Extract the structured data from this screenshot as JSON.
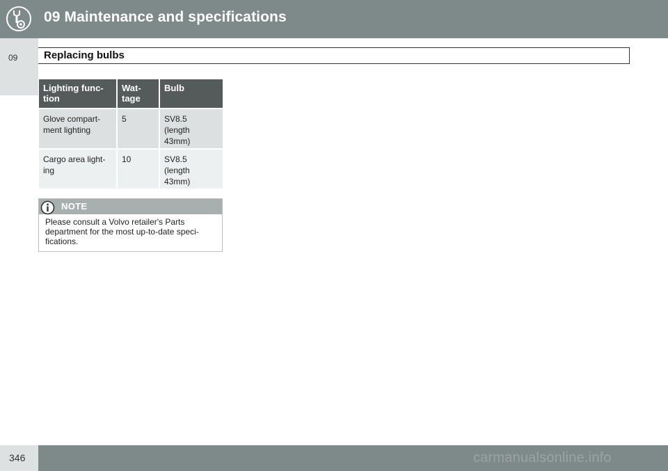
{
  "header": {
    "chapter_title": "09 Maintenance and specifications",
    "chapter_icon": "wrench-gear-icon"
  },
  "side_tab": {
    "chapter_number": "09"
  },
  "section": {
    "title": "Replacing bulbs"
  },
  "table": {
    "columns": [
      "Lighting func-\ntion",
      "Wat-\ntage",
      "Bulb"
    ],
    "rows": [
      [
        "Glove compart-\nment lighting",
        "5",
        "SV8.5\n(length\n43mm)"
      ],
      [
        "Cargo area light-\ning",
        "10",
        "SV8.5\n(length\n43mm)"
      ]
    ]
  },
  "note": {
    "icon": "info-icon",
    "label": "NOTE",
    "text": "Please consult a Volvo retailer's Parts\ndepartment for the most up-to-date speci-\nfications."
  },
  "footer": {
    "page_number": "346",
    "watermark": "carmanualsonline.info"
  },
  "colors": {
    "bar": "#7e8a89",
    "table_header": "#545b5a",
    "row_dark": "#dde0e0",
    "row_light": "#edf0f0",
    "note_header": "#a8b0af"
  }
}
